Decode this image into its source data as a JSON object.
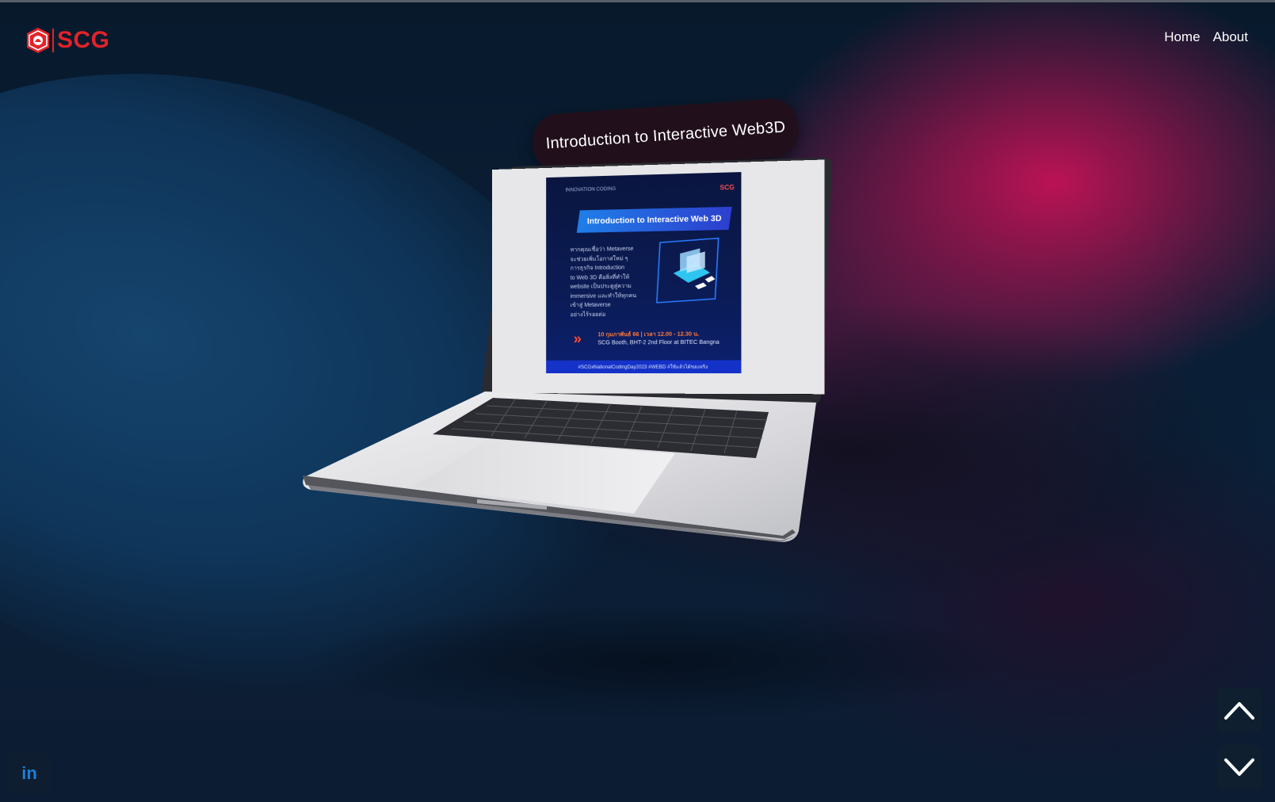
{
  "header": {
    "logo_text": "SCG",
    "nav": [
      {
        "label": "Home"
      },
      {
        "label": "About"
      }
    ]
  },
  "hero": {
    "title": "Introduction to Interactive Web3D"
  },
  "screen_poster": {
    "brand_left": "INNOVATION CODING",
    "brand_right": "SCG",
    "title": "Introduction to Interactive Web 3D",
    "body_lines": [
      "หากคุณเชื่อว่า Metaverse",
      "จะช่วยเพิ่มโอกาสใหม่ ๆ",
      "การธุรกิจ Introduction",
      "to Web 3D คือสิ่งที่ทำให้",
      "website เป็นประตูสู่ความ",
      "immersive และทำให้ทุกคน",
      "เข้าสู่ Metaverse",
      "อย่างไร้รอยต่อ"
    ],
    "date": "10 กุมภาพันธ์ 66 | เวลา 12.00 - 12.30 น.",
    "location": "SCG Booth, BHT-2 2nd Floor at BITEC Bangna",
    "footer": "#SCGxNationalCodingDay2023 #WEBD #ใช้แล้วได้ของจริง"
  },
  "controls": {
    "up_icon": "chevron-up-icon",
    "down_icon": "chevron-down-icon",
    "social_label": "in"
  },
  "colors": {
    "brand_red": "#e2232a",
    "accent_magenta": "#c41256",
    "background_navy": "#0a2038",
    "linkedin_blue": "#1d7fd6"
  }
}
